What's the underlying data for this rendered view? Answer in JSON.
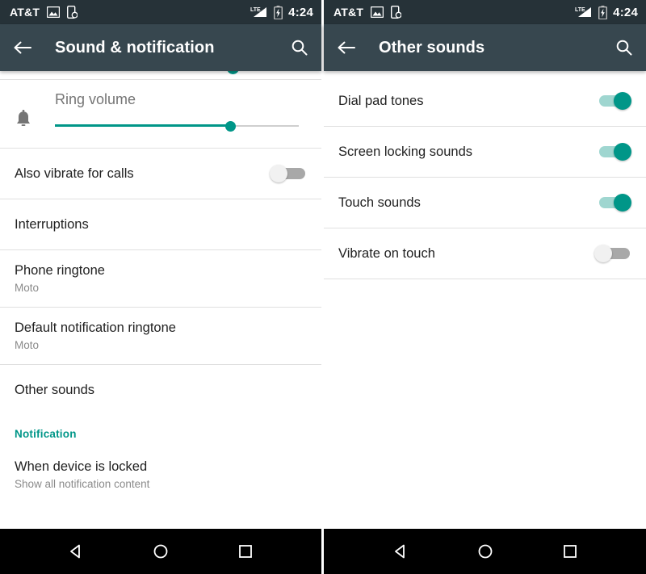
{
  "status_bar": {
    "carrier": "AT&T",
    "time": "4:24",
    "network_type": "LTE",
    "icons": [
      "image-icon",
      "sim-shield-icon",
      "lte-signal-icon",
      "battery-charging-icon"
    ]
  },
  "colors": {
    "accent_teal": "#009688",
    "toolbar_bg": "#37474F",
    "status_bar_bg": "#263238",
    "navbar_bg": "#000000",
    "divider": "#e0e0e0",
    "primary_text": "#212121",
    "secondary_text": "#8a8a8a"
  },
  "left_screen": {
    "toolbar": {
      "title": "Sound & notification",
      "back_icon": "arrow-back-icon",
      "search_icon": "search-icon"
    },
    "volume": {
      "label": "Ring volume",
      "icon": "bell-icon",
      "value_percent": 72
    },
    "items": [
      {
        "title": "Also vibrate for calls",
        "type": "switch",
        "state": "off"
      },
      {
        "title": "Interruptions",
        "type": "nav"
      },
      {
        "title": "Phone ringtone",
        "subtitle": "Moto",
        "type": "nav"
      },
      {
        "title": "Default notification ringtone",
        "subtitle": "Moto",
        "type": "nav"
      },
      {
        "title": "Other sounds",
        "type": "nav"
      }
    ],
    "section_header": "Notification",
    "section_items": [
      {
        "title": "When device is locked",
        "subtitle": "Show all notification content",
        "type": "nav"
      }
    ]
  },
  "right_screen": {
    "toolbar": {
      "title": "Other sounds",
      "back_icon": "arrow-back-icon",
      "search_icon": "search-icon"
    },
    "items": [
      {
        "title": "Dial pad tones",
        "type": "switch",
        "state": "on"
      },
      {
        "title": "Screen locking sounds",
        "type": "switch",
        "state": "on"
      },
      {
        "title": "Touch sounds",
        "type": "switch",
        "state": "on"
      },
      {
        "title": "Vibrate on touch",
        "type": "switch",
        "state": "off"
      }
    ]
  },
  "nav_bar": {
    "back_label": "Back",
    "home_label": "Home",
    "recents_label": "Recent apps"
  }
}
